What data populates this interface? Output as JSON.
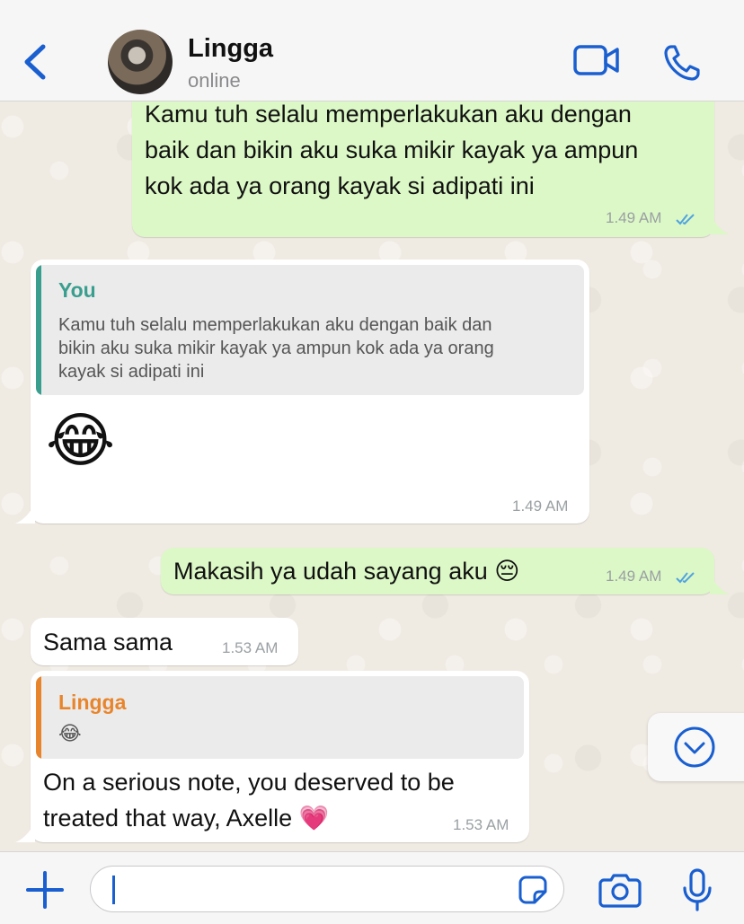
{
  "header": {
    "contact_name": "Lingga",
    "status": "online"
  },
  "messages": [
    {
      "direction": "outgoing",
      "text": "Kamu tuh selalu memperlakukan aku dengan baik dan bikin aku suka mikir kayak ya ampun kok ada ya orang kayak si adipati ini",
      "lines": [
        "Kamu tuh selalu memperlakukan aku dengan",
        "baik dan bikin aku suka mikir kayak ya ampun",
        "kok ada ya orang kayak si adipati ini"
      ],
      "time": "1.49 AM",
      "read": true
    },
    {
      "direction": "incoming",
      "reply_to": {
        "author": "You",
        "lines": [
          "Kamu tuh selalu memperlakukan aku dengan baik dan",
          "bikin aku suka mikir kayak ya ampun kok ada ya orang",
          "kayak si adipati ini"
        ]
      },
      "text": "😂",
      "time": "1.49 AM"
    },
    {
      "direction": "outgoing",
      "text": "Makasih ya udah sayang aku 😔",
      "time": "1.49 AM",
      "read": true
    },
    {
      "direction": "incoming",
      "text": "Sama sama",
      "time": "1.53 AM"
    },
    {
      "direction": "incoming",
      "reply_to": {
        "author": "Lingga",
        "text": "😂"
      },
      "lines": [
        "On a serious note, you deserved to be",
        "treated that way, Axelle 💗"
      ],
      "time": "1.53 AM"
    }
  ],
  "colors": {
    "accent": "#1a5fd0",
    "outgoing_bubble": "#dcf8c6",
    "incoming_bubble": "#ffffff",
    "quote_you": "#3a9e8f",
    "quote_lingga": "#e8852c",
    "read_ticks": "#4fa3e0"
  },
  "icons": {
    "back": "chevron-left-icon",
    "video": "video-camera-icon",
    "call": "phone-icon",
    "scroll": "chevron-down-circle-icon",
    "plus": "plus-icon",
    "sticker": "sticker-icon",
    "camera": "camera-icon",
    "mic": "microphone-icon"
  }
}
